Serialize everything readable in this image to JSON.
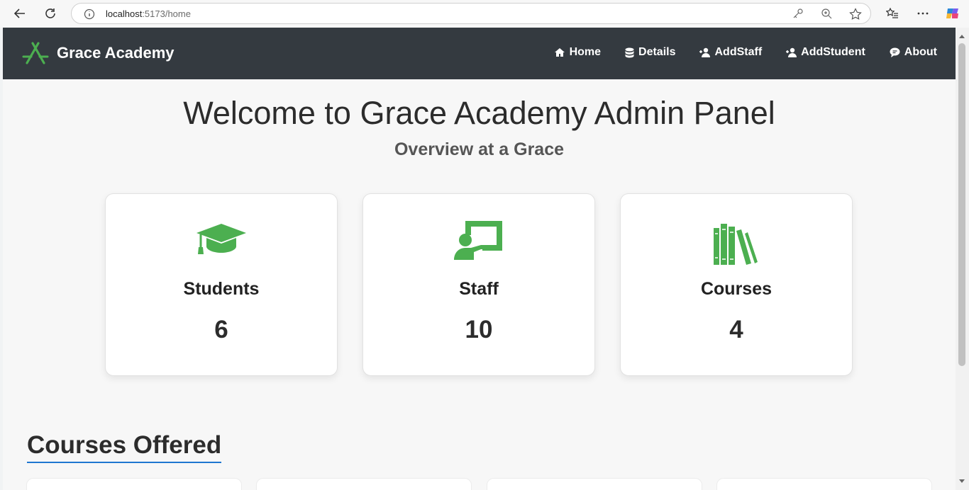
{
  "browser": {
    "url_host": "localhost",
    "url_rest": ":5173/home"
  },
  "brand": {
    "name": "Grace Academy",
    "color": "#4caf50"
  },
  "nav": [
    {
      "label": "Home",
      "icon": "home-icon"
    },
    {
      "label": "Details",
      "icon": "database-icon"
    },
    {
      "label": "AddStaff",
      "icon": "user-plus-icon"
    },
    {
      "label": "AddStudent",
      "icon": "user-plus-icon"
    },
    {
      "label": "About",
      "icon": "comment-icon"
    }
  ],
  "hero": {
    "title": "Welcome to Grace Academy Admin Panel",
    "subtitle": "Overview at a Grace"
  },
  "stats": [
    {
      "label": "Students",
      "value": "6",
      "icon": "graduation-cap-icon"
    },
    {
      "label": "Staff",
      "value": "10",
      "icon": "chalkboard-teacher-icon"
    },
    {
      "label": "Courses",
      "value": "4",
      "icon": "books-icon"
    }
  ],
  "courses_section": {
    "title": "Courses Offered"
  },
  "colors": {
    "accent": "#4caf50",
    "navbar": "#343a40",
    "underline": "#1f77d0"
  }
}
